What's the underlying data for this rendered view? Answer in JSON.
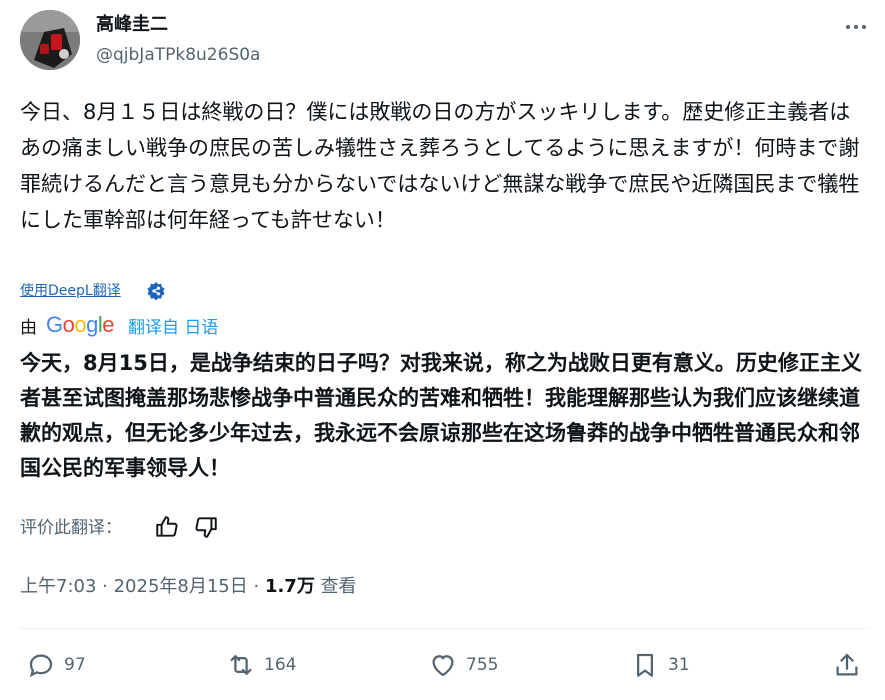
{
  "author": {
    "name": "高峰圭二",
    "handle": "@qjbJaTPk8u26S0a"
  },
  "tweet": {
    "text": "今日、8月１５日は終戦の日？僕には敗戦の日の方がスッキリします。歴史修正主義者はあの痛ましい戦争の庶民の苦しみ犠牲さえ葬ろうとしてるように思えますが！何時まで謝罪続けるんだと言う意見も分からないではないけど無謀な戦争で庶民や近隣国民まで犠牲にした軍幹部は何年経っても許せない！"
  },
  "translate": {
    "deepl_link": "使用DeepL翻译",
    "by_label": "由",
    "google_logo": "Google",
    "translated_from": "翻译自 日语",
    "translated_text": "今天，8月15日，是战争结束的日子吗？对我来说，称之为战败日更有意义。历史修正主义者甚至试图掩盖那场悲惨战争中普通民众的苦难和牺牲！我能理解那些认为我们应该继续道歉的观点，但无论多少年过去，我永远不会原谅那些在这场鲁莽的战争中牺牲普通民众和邻国公民的军事领导人！",
    "rate_label": "评价此翻译："
  },
  "meta": {
    "time": "上午7:03",
    "sep1": " · ",
    "date": "2025年8月15日",
    "sep2": " · ",
    "views": "1.7万",
    "views_label": " 查看"
  },
  "actions": {
    "replies": "97",
    "reposts": "164",
    "likes": "755",
    "bookmarks": "31"
  },
  "colors": {
    "accent": "#1d9bf0",
    "link": "#1d65b8",
    "muted": "#536471",
    "text": "#0f1419"
  },
  "icons": [
    "more-icon",
    "deepl-verified-icon",
    "thumbs-up-icon",
    "thumbs-down-icon",
    "reply-icon",
    "repost-icon",
    "like-icon",
    "bookmark-icon",
    "share-icon"
  ]
}
